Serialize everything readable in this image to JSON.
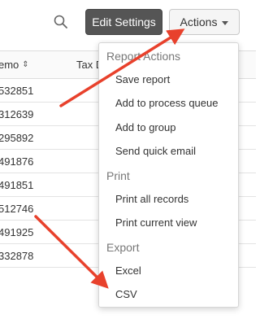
{
  "toolbar": {
    "search_icon": "search-icon",
    "edit_settings_label": "Edit Settings",
    "actions_label": "Actions"
  },
  "table": {
    "columns": [
      "emo",
      "Tax D"
    ],
    "rows": [
      "532851",
      "312639",
      "295892",
      "491876",
      "491851",
      "512746",
      "491925",
      "332878"
    ]
  },
  "dropdown": {
    "sections": [
      {
        "title": "Report Actions",
        "items": [
          "Save report",
          "Add to process queue",
          "Add to group",
          "Send quick email"
        ]
      },
      {
        "title": "Print",
        "items": [
          "Print all records",
          "Print current view"
        ]
      },
      {
        "title": "Export",
        "items": [
          "Excel",
          "CSV"
        ]
      }
    ]
  },
  "colors": {
    "annotation_arrow": "#e8412c",
    "edit_button_bg": "#555555",
    "actions_button_bg": "#f5f5f5"
  }
}
